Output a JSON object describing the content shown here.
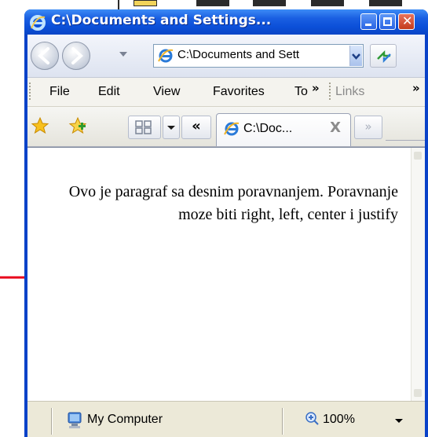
{
  "window": {
    "title": "C:\\Documents and Settings..."
  },
  "navigation": {
    "address": "C:\\Documents and Sett"
  },
  "menu": {
    "items": [
      "File",
      "Edit",
      "View",
      "Favorites",
      "To"
    ],
    "chevron": "»",
    "links_label": "Links",
    "links_chevron": "»"
  },
  "toolbar": {
    "back_tabs_label": "«",
    "tab_title": "C:\\Doc...",
    "tab_close": "X",
    "new_tab_label": "»"
  },
  "content": {
    "paragraph": "Ovo je paragraf sa desnim poravnanjem. Poravnanje moze biti right, left, center i justify"
  },
  "status": {
    "zone": "My Computer",
    "zoom": "100%"
  },
  "colors": {
    "title_bar": "#0a46c6",
    "annotation_arrow": "#e8001a"
  }
}
